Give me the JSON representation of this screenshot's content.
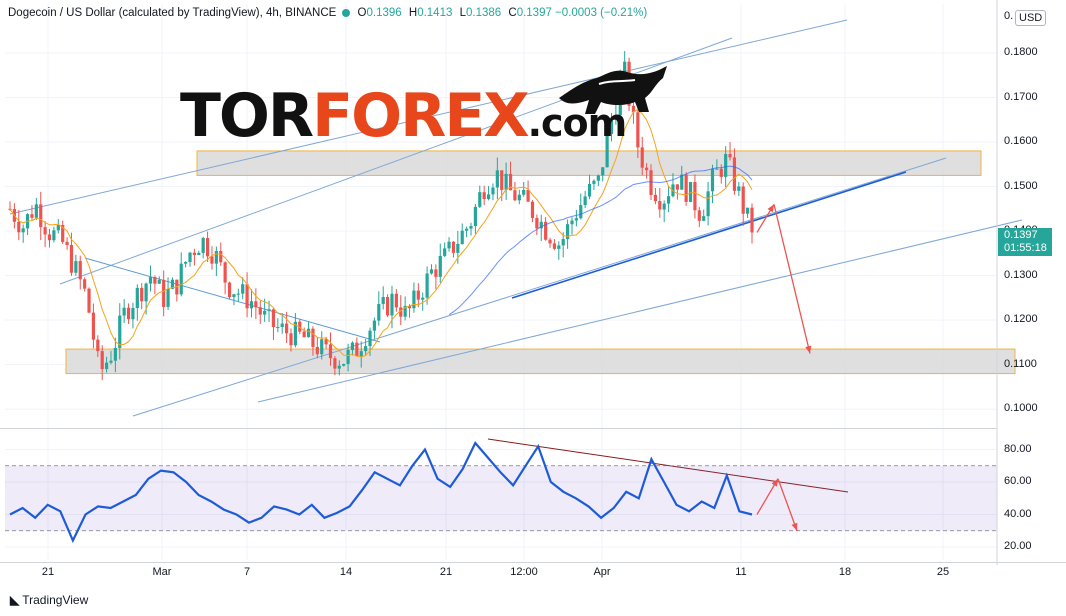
{
  "header": {
    "title": "Dogecoin / US Dollar (calculated by TradingView), 4h, BINANCE",
    "o_label": "O",
    "o_value": "0.1396",
    "h_label": "H",
    "h_value": "0.1413",
    "l_label": "L",
    "l_value": "0.1386",
    "c_label": "C",
    "c_value": "0.1397",
    "change": "−0.0003 (−0.21%)"
  },
  "currency": "USD",
  "currency_partial_tick": "0.",
  "price_box": {
    "price": "0.1397",
    "countdown": "01:55:18",
    "color": "#26a69a"
  },
  "logo": {
    "part1": "TOR",
    "part2": "FOREX",
    "part3": ".com",
    "accent": "#e8461b",
    "icon": "bull-icon"
  },
  "branding": {
    "icon": "tradingview-icon",
    "text": "TradingView"
  },
  "chart_data": [
    {
      "type": "candlestick",
      "title": "Dogecoin / US Dollar (calculated by TradingView), 4h, BINANCE",
      "y_ticks": [
        "0.1800",
        "0.1700",
        "0.1600",
        "0.1500",
        "0.1400",
        "0.1300",
        "0.1200",
        "0.1100",
        "0.1000"
      ],
      "x_ticks": [
        "21",
        "Mar",
        "7",
        "14",
        "21",
        "12:00",
        "Apr",
        "11",
        "18",
        "25"
      ],
      "ylim": [
        0.096,
        0.191
      ],
      "grid": true,
      "colors": {
        "up": "#26a69a",
        "down": "#ef5350",
        "ma_fast": "#f7a21b",
        "ma_slow": "#2962ff",
        "channel": "#5b9bd5"
      },
      "price_path": [
        0.145,
        0.141,
        0.146,
        0.14,
        0.138,
        0.132,
        0.125,
        0.108,
        0.113,
        0.122,
        0.126,
        0.13,
        0.125,
        0.128,
        0.135,
        0.138,
        0.135,
        0.128,
        0.126,
        0.124,
        0.12,
        0.118,
        0.117,
        0.116,
        0.114,
        0.112,
        0.111,
        0.113,
        0.118,
        0.122,
        0.125,
        0.121,
        0.126,
        0.131,
        0.134,
        0.138,
        0.142,
        0.15,
        0.153,
        0.149,
        0.147,
        0.144,
        0.14,
        0.137,
        0.143,
        0.148,
        0.151,
        0.165,
        0.176,
        0.16,
        0.151,
        0.147,
        0.152,
        0.149,
        0.144,
        0.152,
        0.156,
        0.148,
        0.1397
      ],
      "support_zone": [
        0.108,
        0.1135
      ],
      "resistance_zone": [
        0.1525,
        0.158
      ],
      "forecast_path": [
        0.1397,
        0.146,
        0.1125
      ]
    },
    {
      "type": "line",
      "name": "RSI",
      "y_ticks": [
        "80.00",
        "60.00",
        "40.00",
        "20.00"
      ],
      "ylim": [
        12,
        92
      ],
      "bands": [
        30,
        70
      ],
      "values": [
        40,
        44,
        38,
        46,
        42,
        24,
        40,
        45,
        44,
        48,
        52,
        62,
        67,
        66,
        60,
        52,
        48,
        43,
        40,
        35,
        38,
        45,
        43,
        40,
        46,
        38,
        41,
        45,
        55,
        66,
        62,
        58,
        70,
        80,
        62,
        57,
        68,
        84,
        75,
        66,
        58,
        70,
        82,
        60,
        54,
        50,
        45,
        38,
        44,
        54,
        50,
        74,
        60,
        46,
        42,
        48,
        44,
        64,
        42,
        40
      ],
      "forecast_path": [
        40,
        62,
        30
      ]
    }
  ]
}
